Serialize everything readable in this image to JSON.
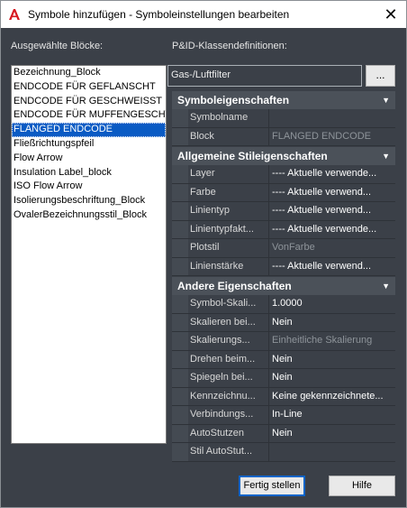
{
  "window": {
    "title": "Symbole hinzufügen - Symboleinstellungen bearbeiten",
    "close_glyph": "✕"
  },
  "labels": {
    "selected_blocks": "Ausgewählte Blöcke:",
    "pid_class_defs": "P&ID-Klassendefinitionen:"
  },
  "blocks": {
    "items": [
      {
        "label": "Bezeichnung_Block",
        "selected": false
      },
      {
        "label": "ENDCODE FÜR GEFLANSCHT",
        "selected": false
      },
      {
        "label": "ENDCODE FÜR GESCHWEISST",
        "selected": false
      },
      {
        "label": "ENDCODE FÜR MUFFENGESCHWEI",
        "selected": false
      },
      {
        "label": "FLANGED ENDCODE",
        "selected": true
      },
      {
        "label": "Fließrichtungspfeil",
        "selected": false
      },
      {
        "label": "Flow Arrow",
        "selected": false
      },
      {
        "label": "Insulation Label_block",
        "selected": false
      },
      {
        "label": "ISO Flow Arrow",
        "selected": false
      },
      {
        "label": "Isolierungsbeschriftung_Block",
        "selected": false
      },
      {
        "label": "OvalerBezeichnungsstil_Block",
        "selected": false
      }
    ]
  },
  "class_field": {
    "value": "Gas-/Luftfilter",
    "browse_label": "..."
  },
  "sections": [
    {
      "title": "Symboleigenschaften",
      "rows": [
        {
          "key": "Symbolname",
          "value": "",
          "disabled": false
        },
        {
          "key": "Block",
          "value": "FLANGED ENDCODE",
          "disabled": true
        }
      ]
    },
    {
      "title": "Allgemeine Stileigenschaften",
      "rows": [
        {
          "key": "Layer",
          "value": "---- Aktuelle verwende...",
          "disabled": false
        },
        {
          "key": "Farbe",
          "value": " ---- Aktuelle verwend...",
          "disabled": false
        },
        {
          "key": "Linientyp",
          "value": "---- Aktuelle verwend...",
          "disabled": false
        },
        {
          "key": "Linientypfakt...",
          "value": "---- Aktuelle verwende...",
          "disabled": false
        },
        {
          "key": "Plotstil",
          "value": "VonFarbe",
          "disabled": true
        },
        {
          "key": "Linienstärke",
          "value": "---- Aktuelle verwend...",
          "disabled": false
        }
      ]
    },
    {
      "title": "Andere Eigenschaften",
      "rows": [
        {
          "key": "Symbol-Skali...",
          "value": "1.0000",
          "disabled": false
        },
        {
          "key": "Skalieren bei...",
          "value": "Nein",
          "disabled": false
        },
        {
          "key": "Skalierungs...",
          "value": "Einheitliche Skalierung",
          "disabled": true
        },
        {
          "key": "Drehen beim...",
          "value": "Nein",
          "disabled": false
        },
        {
          "key": "Spiegeln bei...",
          "value": "Nein",
          "disabled": false
        },
        {
          "key": "Kennzeichnu...",
          "value": "Keine gekennzeichnete...",
          "disabled": false
        },
        {
          "key": "Verbindungs...",
          "value": "In-Line",
          "disabled": false
        },
        {
          "key": "AutoStutzen",
          "value": "Nein",
          "disabled": false
        },
        {
          "key": "Stil AutoStut...",
          "value": "",
          "disabled": false
        }
      ]
    }
  ],
  "buttons": {
    "finish": "Fertig stellen",
    "help": "Hilfe"
  }
}
